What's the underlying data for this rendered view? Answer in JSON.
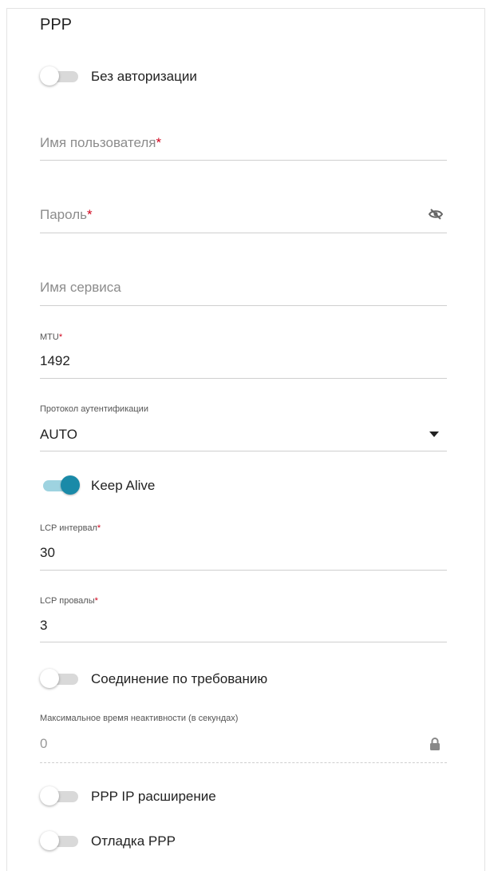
{
  "section_title": "PPP",
  "no_auth": {
    "label": "Без авторизации",
    "on": false
  },
  "username": {
    "placeholder": "Имя пользователя",
    "required_mark": "*"
  },
  "password": {
    "placeholder": "Пароль",
    "required_mark": "*",
    "icon": "eye-off-icon"
  },
  "service_name": {
    "placeholder": "Имя сервиса"
  },
  "mtu": {
    "label": "MTU",
    "required_mark": "*",
    "value": "1492"
  },
  "auth_protocol": {
    "label": "Протокол аутентификации",
    "value": "AUTO",
    "icon": "dropdown-arrow-icon"
  },
  "keep_alive": {
    "label": "Keep Alive",
    "on": true
  },
  "lcp_interval": {
    "label": "LCP интервал",
    "required_mark": "*",
    "value": "30"
  },
  "lcp_failures": {
    "label": "LCP провалы",
    "required_mark": "*",
    "value": "3"
  },
  "on_demand": {
    "label": "Соединение по требованию",
    "on": false
  },
  "max_idle": {
    "label": "Максимальное время неактивности (в секундах)",
    "value": "0",
    "icon": "lock-icon"
  },
  "ppp_ip_ext": {
    "label": "PPP IP расширение",
    "on": false
  },
  "ppp_debug": {
    "label": "Отладка PPP",
    "on": false
  },
  "colors": {
    "accent": "#1a8aa8",
    "accent_track": "#9ed3e0",
    "required": "#d0021b"
  }
}
